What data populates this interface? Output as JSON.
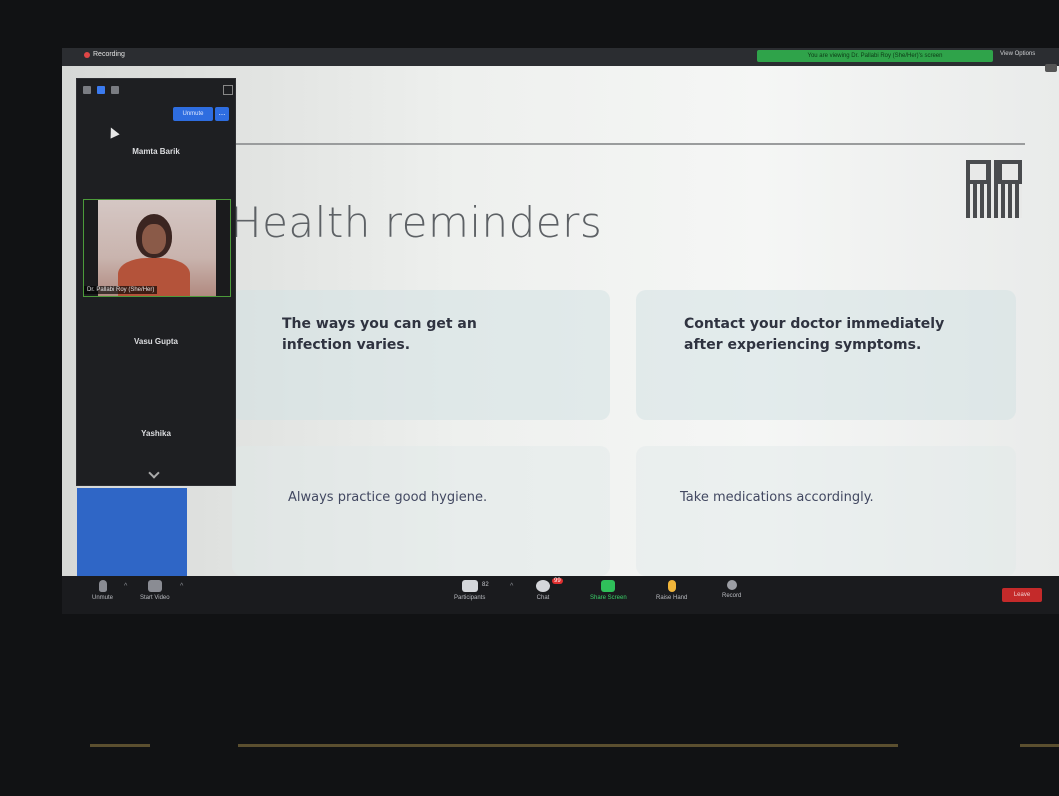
{
  "window": {
    "recording_label": "Recording",
    "viewing_banner": "You are viewing Dr. Pallabi Roy (She/Her)'s screen",
    "view_options_label": "View Options"
  },
  "slide": {
    "title": "Health reminders",
    "cards": [
      "The ways you can get an infection varies.",
      "Contact your doctor immediately after experiencing symptoms.",
      "Always practice good hygiene.",
      "Take medications accordingly."
    ]
  },
  "participants_panel": {
    "unmute_label": "Unmute",
    "more_label": "...",
    "participants": [
      {
        "name": "Mamta Barik"
      },
      {
        "name": "Dr. Pallabi Roy (She/Her)"
      },
      {
        "name": "Vasu Gupta"
      },
      {
        "name": "Yashika"
      }
    ]
  },
  "toolbar": {
    "mute_label": "Unmute",
    "video_label": "Start Video",
    "participants_label": "Participants",
    "participants_count": "82",
    "chat_label": "Chat",
    "chat_badge": "99",
    "share_label": "Share Screen",
    "hand_label": "Raise Hand",
    "record_label": "Record",
    "leave_label": "Leave"
  },
  "colors": {
    "share_green": "#2fbf5a",
    "leave_red": "#c42a2a",
    "accent_blue": "#2e6de0"
  }
}
